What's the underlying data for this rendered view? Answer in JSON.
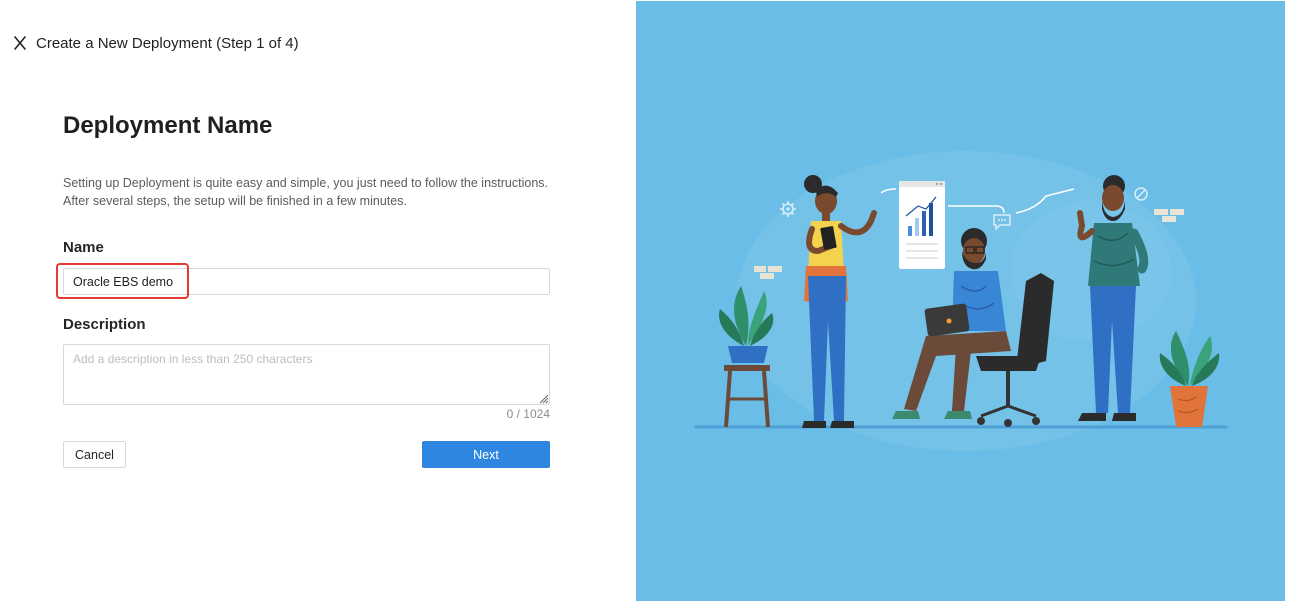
{
  "header": {
    "title": "Create a New Deployment (Step 1 of 4)",
    "close_icon": "close-icon"
  },
  "form": {
    "heading": "Deployment Name",
    "intro_line1": "Setting up Deployment is quite easy and simple, you just need to follow the instructions.",
    "intro_line2": "After several steps, the setup will be finished in a few minutes.",
    "name_label": "Name",
    "name_value": "Oracle EBS demo",
    "description_label": "Description",
    "description_value": "",
    "description_placeholder": "Add a description in less than 250 characters",
    "char_count": "0 / 1024"
  },
  "actions": {
    "cancel_label": "Cancel",
    "next_label": "Next"
  },
  "colors": {
    "primary": "#2e86e0",
    "highlight": "#e53935",
    "illustration_bg": "#6abde6"
  },
  "illustration": {
    "icons": [
      "person-with-tablet-icon",
      "person-with-laptop-icon",
      "person-standing-icon",
      "chart-board-icon",
      "potted-plant-icon",
      "gear-icon",
      "chat-bubble-icon"
    ]
  }
}
